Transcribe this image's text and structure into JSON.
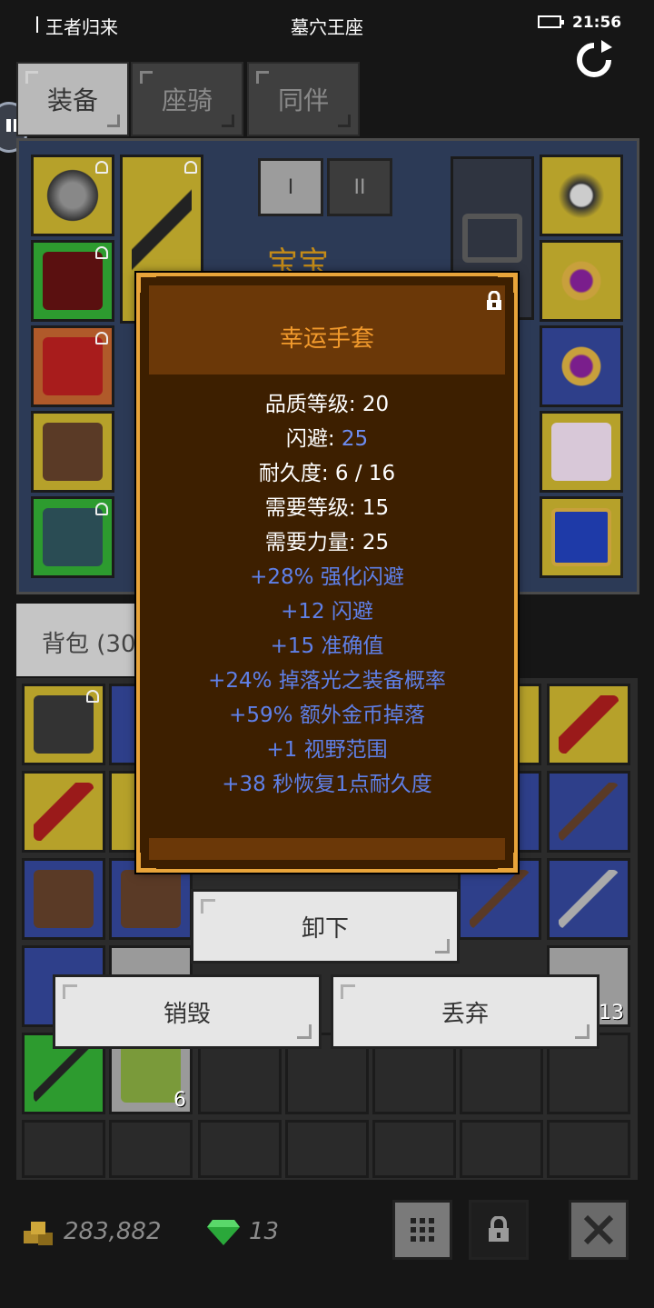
{
  "status_bar": {
    "app_name": "王者归来",
    "title": "墓穴王座",
    "time": "21:56"
  },
  "tabs": [
    {
      "label": "装备",
      "active": true
    },
    {
      "label": "座骑",
      "active": false
    },
    {
      "label": "同伴",
      "active": false
    }
  ],
  "equip_sets": [
    "I",
    "II"
  ],
  "pet_name": "宝宝",
  "bag_tab": {
    "label": "背包 (30"
  },
  "bag_counts": {
    "slot_13": "13",
    "slot_6": "6"
  },
  "currency": {
    "gold": "283,882",
    "gems": "13"
  },
  "item_popup": {
    "title": "幸运手套",
    "title_color": "#f29a2c",
    "stats": [
      {
        "label": "品质等级: ",
        "value": "20"
      },
      {
        "label": "闪避: ",
        "value": "25"
      },
      {
        "label": "耐久度: ",
        "value": "6 / 16"
      },
      {
        "label": "需要等级: ",
        "value": "15"
      },
      {
        "label": "需要力量: ",
        "value": "25"
      }
    ],
    "bonuses": [
      "+28% 强化闪避",
      "+12 闪避",
      "+15 准确值",
      "+24% 掉落光之装备概率",
      "+59% 额外金币掉落",
      "+1 视野范围",
      "+38 秒恢复1点耐久度"
    ],
    "bonus_color": "#5f80e8"
  },
  "actions": {
    "unequip": "卸下",
    "destroy": "销毁",
    "discard": "丢弃"
  }
}
